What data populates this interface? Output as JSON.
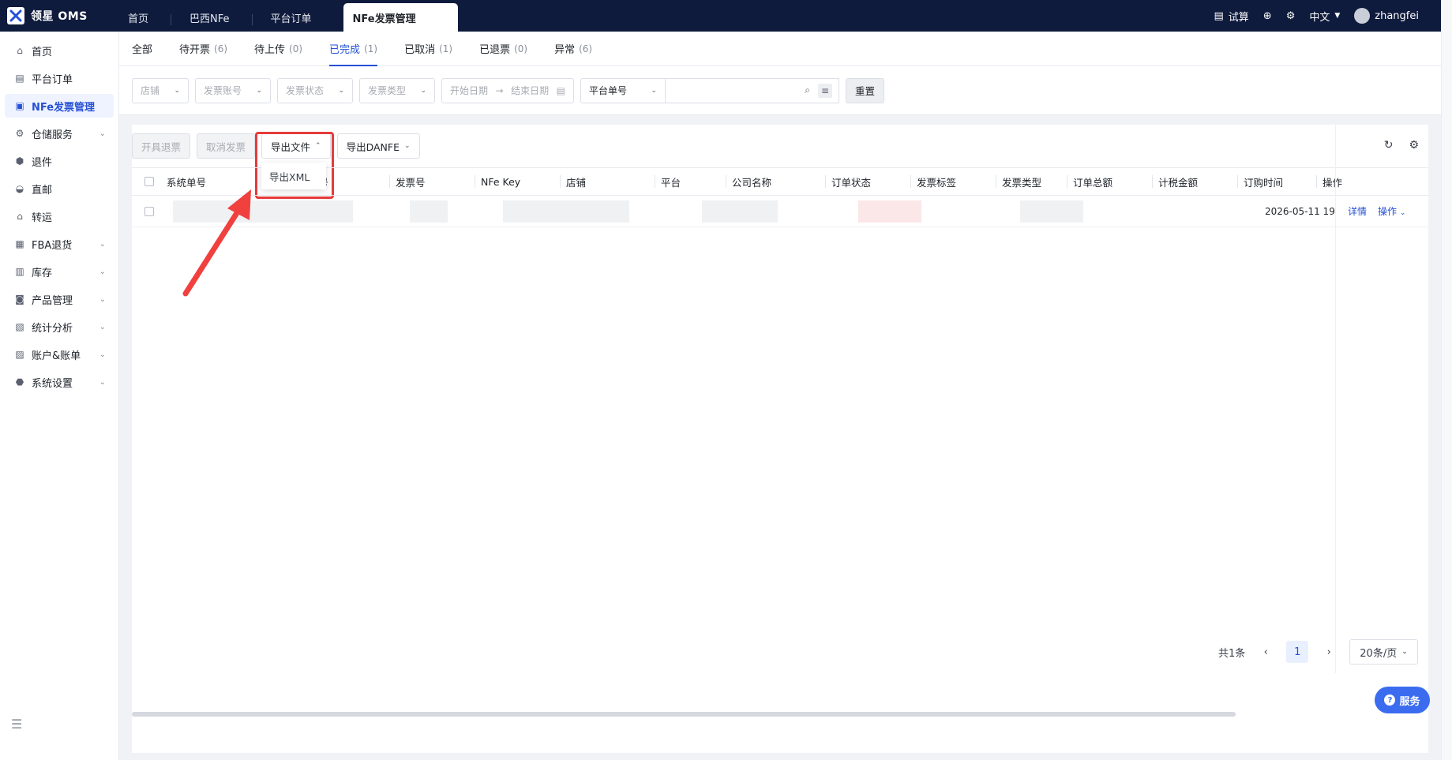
{
  "app": {
    "name": "领星 OMS"
  },
  "top_tabs": [
    {
      "label": "首页"
    },
    {
      "label": "巴西NFe"
    },
    {
      "label": "平台订单"
    },
    {
      "label": "NFe发票管理",
      "active": true
    }
  ],
  "top_right": {
    "trial": "试算",
    "language": "中文",
    "user": "zhangfei"
  },
  "sidebar": {
    "items": [
      {
        "label": "首页",
        "icon": "home-icon"
      },
      {
        "label": "平台订单",
        "icon": "order-icon"
      },
      {
        "label": "NFe发票管理",
        "icon": "invoice-icon",
        "active": true
      },
      {
        "label": "仓储服务",
        "icon": "warehouse-icon",
        "expandable": true
      },
      {
        "label": "退件",
        "icon": "return-icon"
      },
      {
        "label": "直邮",
        "icon": "direct-mail-icon"
      },
      {
        "label": "转运",
        "icon": "transfer-icon"
      },
      {
        "label": "FBA退货",
        "icon": "fba-icon",
        "expandable": true
      },
      {
        "label": "库存",
        "icon": "inventory-icon",
        "expandable": true
      },
      {
        "label": "产品管理",
        "icon": "product-icon",
        "expandable": true
      },
      {
        "label": "统计分析",
        "icon": "stats-icon",
        "expandable": true
      },
      {
        "label": "账户&账单",
        "icon": "account-icon",
        "expandable": true
      },
      {
        "label": "系统设置",
        "icon": "settings-icon",
        "expandable": true
      }
    ]
  },
  "status_tabs": [
    {
      "label": "全部",
      "count": ""
    },
    {
      "label": "待开票",
      "count": "(6)"
    },
    {
      "label": "待上传",
      "count": "(0)"
    },
    {
      "label": "已完成",
      "count": "(1)",
      "active": true
    },
    {
      "label": "已取消",
      "count": "(1)"
    },
    {
      "label": "已退票",
      "count": "(0)"
    },
    {
      "label": "异常",
      "count": "(6)"
    }
  ],
  "filters": {
    "store": "店铺",
    "invoice_account": "发票账号",
    "invoice_status": "发票状态",
    "invoice_type": "发票类型",
    "start_date": "开始日期",
    "date_arrow": "→",
    "end_date": "结束日期",
    "search_field": "平台单号",
    "search_value": "",
    "reset": "重置"
  },
  "toolbar": {
    "refund_invoice": "开具退票",
    "cancel_invoice": "取消发票",
    "export_file": "导出文件",
    "export_danfe": "导出DANFE",
    "export_menu_item": "导出XML"
  },
  "table": {
    "columns": [
      "系统单号",
      "单号",
      "发票号",
      "NFe Key",
      "店铺",
      "平台",
      "公司名称",
      "订单状态",
      "发票标签",
      "发票类型",
      "订单总额",
      "计税金额",
      "订购时间",
      "操作"
    ],
    "rows": [
      {
        "order_time": "2026-05-11 19",
        "detail": "详情",
        "ops": "操作"
      }
    ]
  },
  "pagination": {
    "total": "共1条",
    "current": "1",
    "page_size": "20条/页"
  },
  "service_button": "服务",
  "colors": {
    "topbar": "#0f1b3d",
    "accent": "#2650d6",
    "highlight": "#e63b3b",
    "service": "#3b6cf0"
  }
}
